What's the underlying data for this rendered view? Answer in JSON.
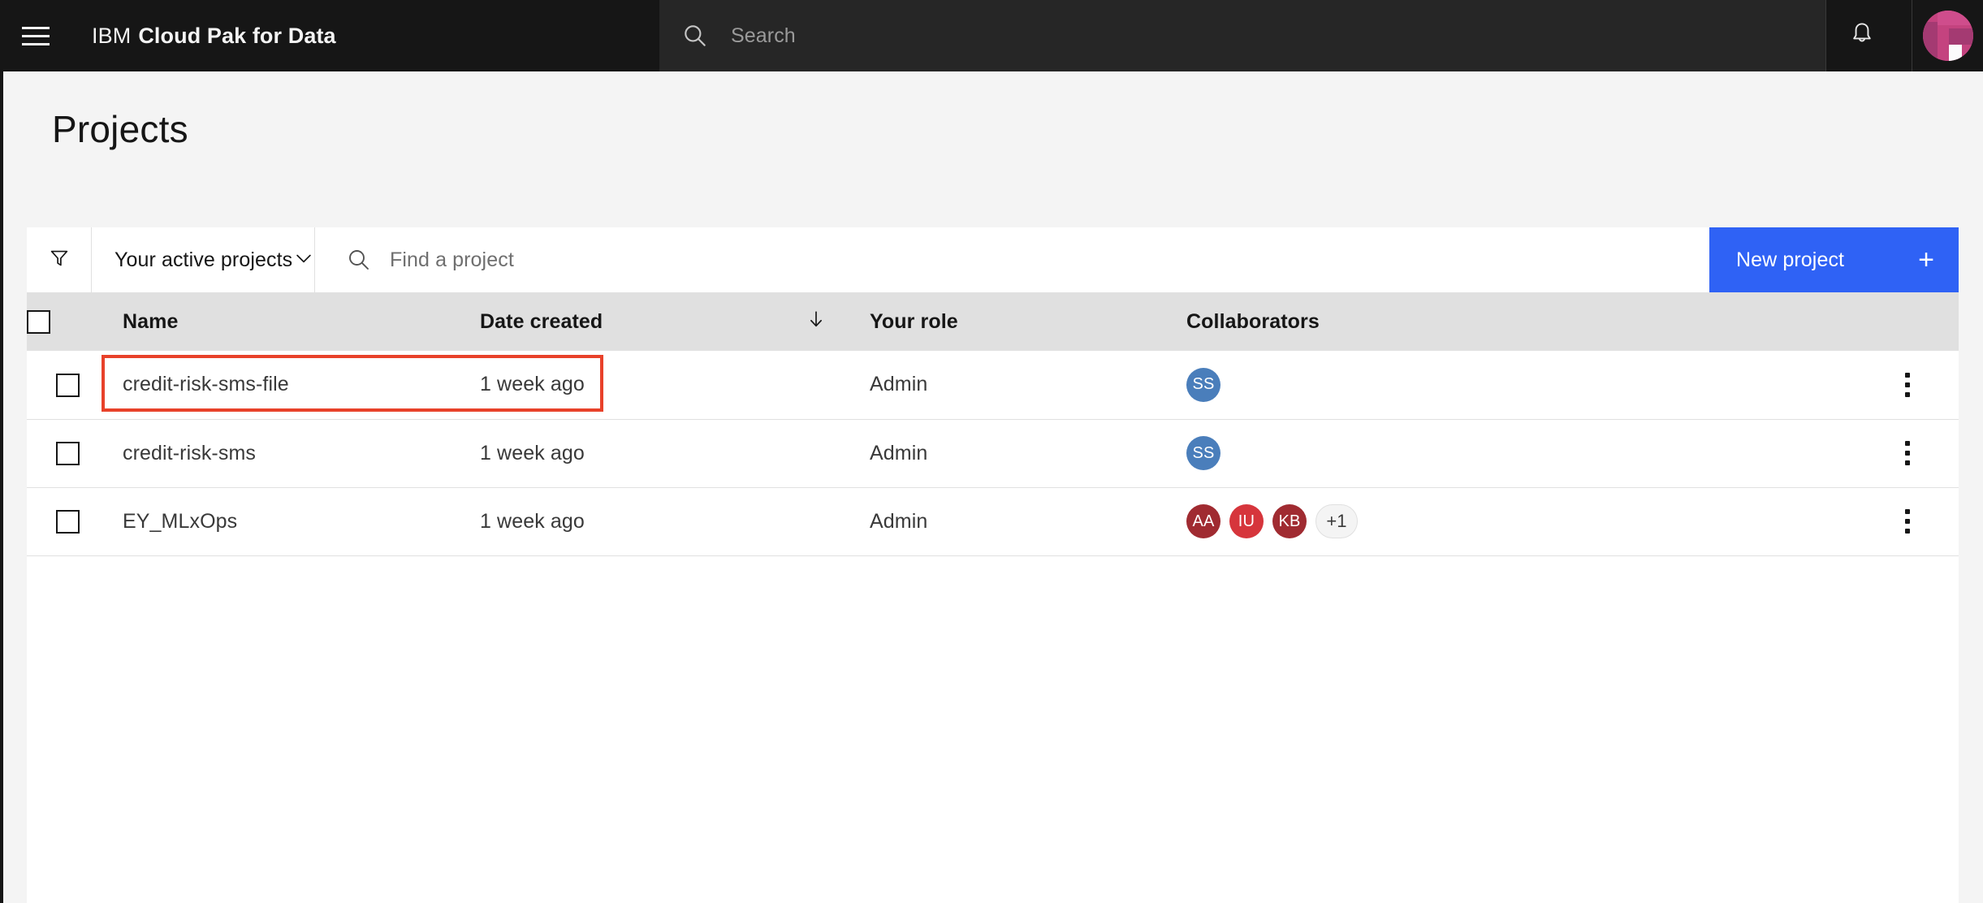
{
  "header": {
    "menu_icon": "hamburger-menu-icon",
    "brand_prefix": "IBM",
    "brand_product": "Cloud Pak for Data",
    "search_placeholder": "Search",
    "search_icon": "search-icon",
    "notification_icon": "bell-icon",
    "avatar_label": "user-avatar",
    "bg_color": "#161616",
    "search_bg_color": "#262626"
  },
  "page": {
    "title": "Projects",
    "bg_color": "#f4f4f4"
  },
  "toolbar": {
    "filter_icon": "filter-funnel-icon",
    "dropdown_value": "Your active projects",
    "dropdown_icon": "chevron-down-icon",
    "find_placeholder": "Find a project",
    "find_icon": "search-icon",
    "new_project_label": "New project",
    "new_project_icon": "plus-icon",
    "new_project_color": "#2f62f5"
  },
  "table": {
    "columns": [
      {
        "label": "",
        "name": "select-all"
      },
      {
        "label": "Name",
        "name": "name"
      },
      {
        "label": "Date created",
        "name": "date-created"
      },
      {
        "label": "Your role",
        "name": "your-role"
      },
      {
        "label": "Collaborators",
        "name": "collaborators"
      },
      {
        "label": "",
        "name": "actions"
      }
    ],
    "sorted_column": "Date created",
    "sort_direction": "descending",
    "sort_icon": "arrow-down-icon",
    "header_bg": "#e0e0e0",
    "sorted_header_bg": "#d1d1d1",
    "rows": [
      {
        "name": "credit-risk-sms-file",
        "date_created": "1 week ago",
        "role": "Admin",
        "highlighted": true,
        "collaborators": [
          {
            "initials": "SS",
            "color": "#4a7ebb"
          }
        ],
        "extra_count": ""
      },
      {
        "name": "credit-risk-sms",
        "date_created": "1 week ago",
        "role": "Admin",
        "highlighted": false,
        "collaborators": [
          {
            "initials": "SS",
            "color": "#4a7ebb"
          }
        ],
        "extra_count": ""
      },
      {
        "name": "EY_MLxOps",
        "date_created": "1 week ago",
        "role": "Admin",
        "highlighted": false,
        "collaborators": [
          {
            "initials": "AA",
            "color": "#a02b31"
          },
          {
            "initials": "IU",
            "color": "#d6353c"
          },
          {
            "initials": "KB",
            "color": "#a02b31"
          }
        ],
        "extra_count": "+1"
      }
    ],
    "overflow_icon": "overflow-menu-vertical-icon",
    "checkbox_name": "row-checkbox"
  },
  "annotation": {
    "color": "#e8412a",
    "target": "credit-risk-sms-file"
  }
}
